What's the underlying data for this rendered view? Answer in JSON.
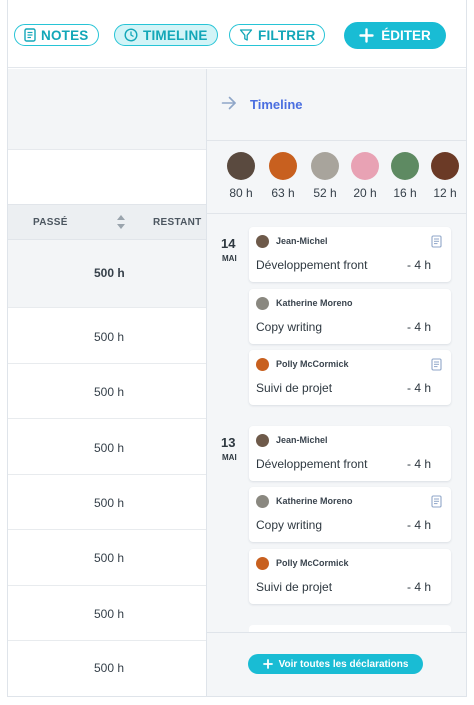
{
  "toolbar": {
    "notes": "NOTES",
    "timeline": "TIMELINE",
    "filter": "FILTRER",
    "edit": "ÉDITER"
  },
  "colors": {
    "accent": "#19bcd4",
    "accent_light": "#d2f4f7",
    "title_blue": "#4a6ee0"
  },
  "table": {
    "col_passe": "PASSÉ",
    "col_restant": "RESTANT",
    "rows": [
      "500 h",
      "500 h",
      "500 h",
      "500 h",
      "500 h",
      "500 h",
      "500 h",
      "500 h"
    ]
  },
  "panel": {
    "title": "Timeline",
    "people": [
      {
        "hours": "80 h",
        "color": "#5a4a3f"
      },
      {
        "hours": "63 h",
        "color": "#c8601f"
      },
      {
        "hours": "52 h",
        "color": "#a8a49c"
      },
      {
        "hours": "20 h",
        "color": "#e8a2b4"
      },
      {
        "hours": "16 h",
        "color": "#5e8a62"
      },
      {
        "hours": "12 h",
        "color": "#6b3a26"
      }
    ],
    "days": [
      {
        "day": "14",
        "month": "MAI",
        "entries": [
          {
            "person": "Jean-Michel",
            "task": "Développement front",
            "duration": "- 4 h",
            "icon": "document-icon",
            "avatar": "#6e5a4a"
          },
          {
            "person": "Katherine Moreno",
            "task": "Copy writing",
            "duration": "- 4 h",
            "icon": "",
            "avatar": "#8a8880"
          },
          {
            "person": "Polly McCormick",
            "task": "Suivi de projet",
            "duration": "- 4 h",
            "icon": "document-icon",
            "avatar": "#c8601f"
          }
        ]
      },
      {
        "day": "13",
        "month": "MAI",
        "entries": [
          {
            "person": "Jean-Michel",
            "task": "Développement front",
            "duration": "- 4 h",
            "icon": "",
            "avatar": "#6e5a4a"
          },
          {
            "person": "Katherine Moreno",
            "task": "Copy writing",
            "duration": "- 4 h",
            "icon": "document-icon",
            "avatar": "#8a8880"
          },
          {
            "person": "Polly McCormick",
            "task": "Suivi de projet",
            "duration": "- 4 h",
            "icon": "",
            "avatar": "#c8601f"
          }
        ]
      }
    ],
    "see_all": "Voir toutes les déclarations"
  }
}
